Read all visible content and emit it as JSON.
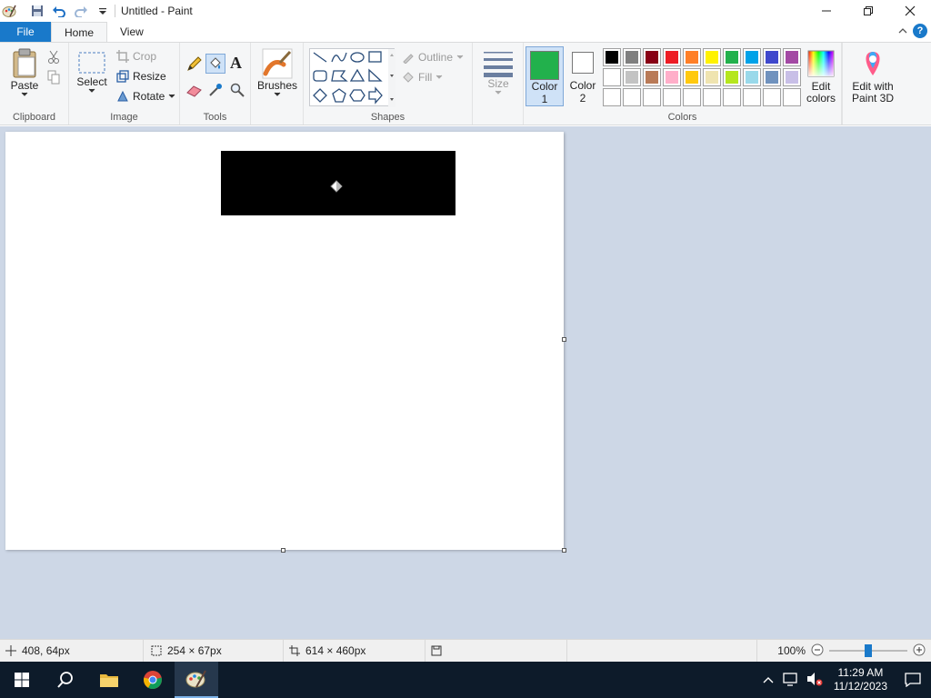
{
  "window": {
    "title": "Untitled - Paint"
  },
  "tabs": {
    "file": "File",
    "home": "Home",
    "view": "View"
  },
  "clipboard": {
    "paste": "Paste",
    "label": "Clipboard"
  },
  "image": {
    "select": "Select",
    "crop": "Crop",
    "resize": "Resize",
    "rotate": "Rotate",
    "label": "Image"
  },
  "tools": {
    "label": "Tools"
  },
  "brushes": {
    "label": "Brushes"
  },
  "shapes": {
    "outline": "Outline",
    "fill": "Fill",
    "label": "Shapes"
  },
  "size": {
    "label": "Size"
  },
  "colors": {
    "color1_line1": "Color",
    "color1_line2": "1",
    "color2_line1": "Color",
    "color2_line2": "2",
    "color1_value": "#22b14c",
    "color2_value": "#ffffff",
    "edit_line1": "Edit",
    "edit_line2": "colors",
    "paint3d_line1": "Edit with",
    "paint3d_line2": "Paint 3D",
    "label": "Colors",
    "palette_row1": [
      "#000000",
      "#7f7f7f",
      "#880015",
      "#ed1c24",
      "#ff7f27",
      "#fff200",
      "#22b14c",
      "#00a2e8",
      "#3f48cc",
      "#a349a4"
    ],
    "palette_row2": [
      "#ffffff",
      "#c3c3c3",
      "#b97a57",
      "#ffaec9",
      "#ffc90e",
      "#efe4b0",
      "#b5e61d",
      "#99d9ea",
      "#7092be",
      "#c8bfe7"
    ]
  },
  "status": {
    "cursor_pos": "408, 64px",
    "selection_size": "254 × 67px",
    "image_size": "614 × 460px",
    "zoom": "100%",
    "zoom_fraction": 0.5
  },
  "taskbar": {
    "time": "11:29 AM",
    "date": "11/12/2023"
  }
}
